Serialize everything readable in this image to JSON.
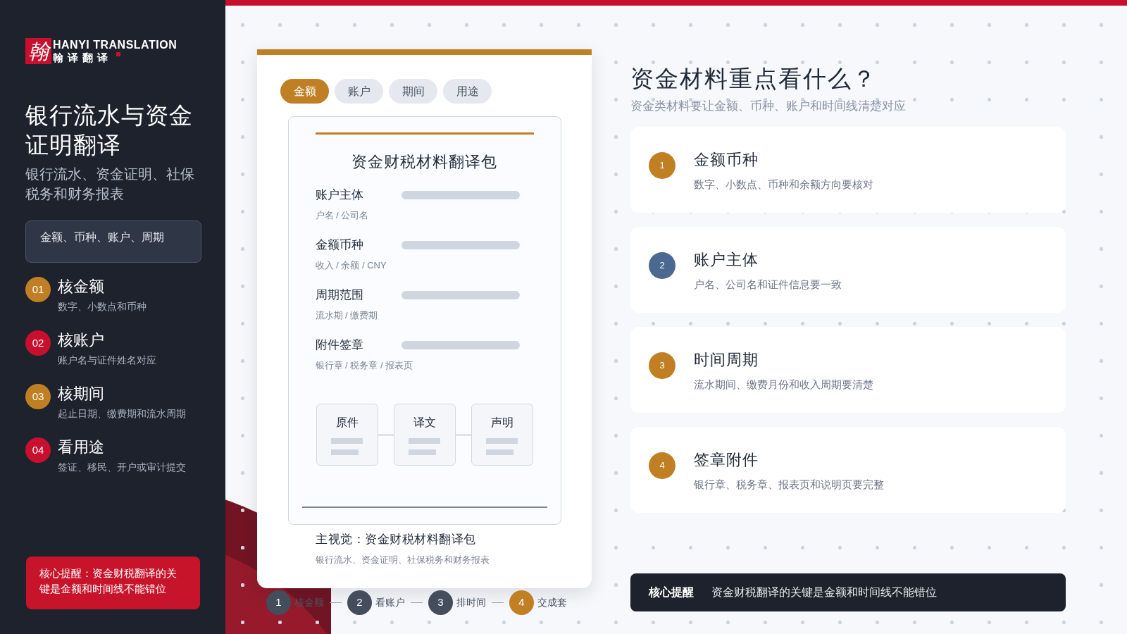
{
  "brand": {
    "logo_mark": "翰",
    "name_en": "HANYI TRANSLATION",
    "name_zh": "翰译翻译"
  },
  "sidebar": {
    "title": "银行流水与资金证明翻译",
    "subtitle": "银行流水、资金证明、社保税务和财务报表",
    "tag": "金额、币种、账户、周期",
    "steps": [
      {
        "number": "01",
        "title": "核金额",
        "text": "数字、小数点和币种",
        "color": "#c17f24"
      },
      {
        "number": "02",
        "title": "核账户",
        "text": "账户名与证件姓名对应",
        "color": "#c8102e"
      },
      {
        "number": "03",
        "title": "核期间",
        "text": "起止日期、缴费期和流水周期",
        "color": "#c17f24"
      },
      {
        "number": "04",
        "title": "看用途",
        "text": "签证、移民、开户或审计提交",
        "color": "#c8102e"
      }
    ],
    "reminder": "核心提醒：资金财税翻译的关键是金额和时间线不能错位"
  },
  "card": {
    "tabs": [
      {
        "label": "金额",
        "selected": true
      },
      {
        "label": "账户",
        "selected": false
      },
      {
        "label": "期间",
        "selected": false
      },
      {
        "label": "用途",
        "selected": false
      }
    ],
    "document": {
      "title": "资金财税材料翻译包",
      "fields": [
        {
          "label": "账户主体",
          "hint": "户名 / 公司名"
        },
        {
          "label": "金额币种",
          "hint": "收入 / 余额 / CNY"
        },
        {
          "label": "周期范围",
          "hint": "流水期 / 缴费期"
        },
        {
          "label": "附件签章",
          "hint": "银行章 / 税务章 / 报表页"
        }
      ],
      "boxes": [
        "原件",
        "译文",
        "声明"
      ]
    },
    "caption_title": "主视觉：资金财税材料翻译包",
    "caption_text": "银行流水、资金证明、社保税务和财务报表"
  },
  "flow": [
    {
      "number": "1",
      "label": "核金额",
      "selected": false
    },
    {
      "number": "2",
      "label": "看账户",
      "selected": false
    },
    {
      "number": "3",
      "label": "排时间",
      "selected": false
    },
    {
      "number": "4",
      "label": "交成套",
      "selected": true
    }
  ],
  "main": {
    "title": "资金材料重点看什么？",
    "subtitle": "资金类材料要让金额、币种、账户和时间线清楚对应",
    "items": [
      {
        "number": "1",
        "title": "金额币种",
        "text": "数字、小数点、币种和余额方向要核对",
        "color": "#c17f24"
      },
      {
        "number": "2",
        "title": "账户主体",
        "text": "户名、公司名和证件信息要一致",
        "color": "#4a6890"
      },
      {
        "number": "3",
        "title": "时间周期",
        "text": "流水期间、缴费月份和收入周期要清楚",
        "color": "#c17f24"
      },
      {
        "number": "4",
        "title": "签章附件",
        "text": "银行章、税务章、报表页和说明页要完整",
        "color": "#c17f24"
      }
    ],
    "reminder": {
      "label": "核心提醒",
      "text": "资金财税翻译的关键是金额和时间线不能错位"
    }
  }
}
